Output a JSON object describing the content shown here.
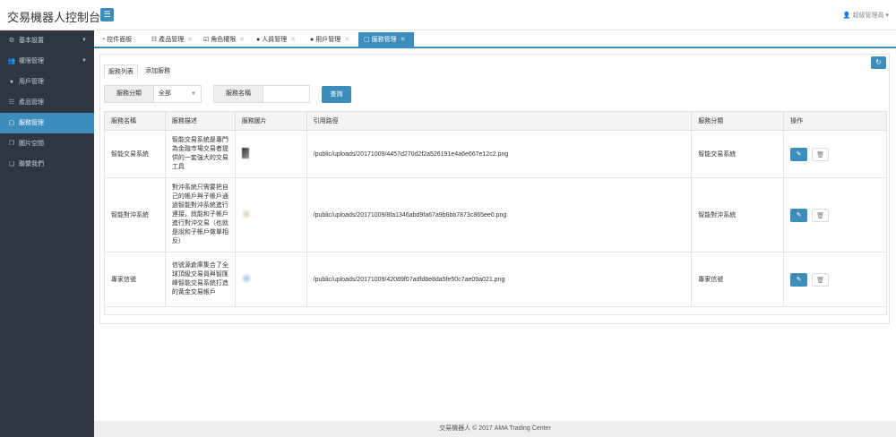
{
  "app": {
    "title": "交易機器人控制台",
    "menu_icon": "menu-icon"
  },
  "user": {
    "name": "超級管理員",
    "icon": "user-icon"
  },
  "sidebar": {
    "items": [
      {
        "label": "基本設置",
        "icon": "cogs-icon",
        "has_caret": true
      },
      {
        "label": "權限管理",
        "icon": "users-icon",
        "has_caret": true
      },
      {
        "label": "用戶管理",
        "icon": "user-icon"
      },
      {
        "label": "產品管理",
        "icon": "sliders-icon"
      },
      {
        "label": "服務管理",
        "icon": "file-icon",
        "active": true
      },
      {
        "label": "圖片空間",
        "icon": "images-icon"
      },
      {
        "label": "聯繫我們",
        "icon": "copy-icon"
      }
    ]
  },
  "tabs": [
    {
      "label": "控件面板",
      "icon": "dashboard-icon"
    },
    {
      "label": "產品管理",
      "icon": "sliders-icon"
    },
    {
      "label": "角色權限",
      "icon": "check-square-icon"
    },
    {
      "label": "人員管理",
      "icon": "user-icon"
    },
    {
      "label": "用戶管理",
      "icon": "user-icon"
    },
    {
      "label": "服務管理",
      "icon": "file-icon",
      "active": true
    }
  ],
  "subtabs": {
    "list": "服務列表",
    "add": "添加服務"
  },
  "filters": {
    "category_label": "服務分類",
    "category_value": "全部",
    "name_label": "服務名稱",
    "name_value": "",
    "query_button": "查詢"
  },
  "table": {
    "headers": [
      "服務名稱",
      "服務描述",
      "服務圖片",
      "引用路徑",
      "服務分類",
      "操作"
    ],
    "rows": [
      {
        "name": "智能交易系統",
        "desc": "智能交易系統是專門為金融市場交易者提供的一套強大的交易工具",
        "path": "/public/uploads/20171009/4457d270d2f2a526191e4a6e667e12c2.png",
        "category": "智能交易系統"
      },
      {
        "name": "智能對沖系統",
        "desc": "對沖系統只需要把自己的帳戶與子帳戶通過智能對沖系統進行連接，就能和子帳戶進行對沖交易（也就是說和子帳戶做單相反）",
        "path": "/public/uploads/20171009/8fa1346abd9fa67a9b6bb7873c865ee0.png",
        "category": "智能對沖系統"
      },
      {
        "name": "專家信號",
        "desc": "信號源倉庫集合了全球頂級交易員與智匯峰智能交易系統打造的黃金交易帳戶",
        "path": "/public/uploads/20171009/42089f07adfd8e8da5fe50c7ae09a021.png",
        "category": "專家信號"
      }
    ]
  },
  "footer": {
    "text": "交易機器人 © 2017  AMA Trading Center"
  },
  "colors": {
    "accent": "#3c8dbc",
    "sidebar_bg": "#2f3642"
  }
}
